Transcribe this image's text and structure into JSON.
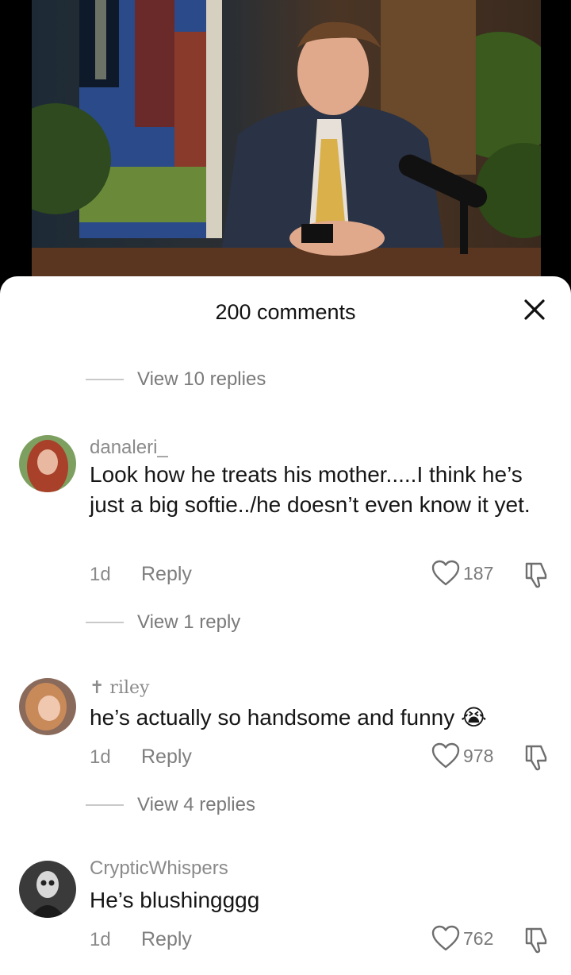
{
  "header": {
    "title": "200 comments"
  },
  "comments": [
    {
      "username": "danaleri_",
      "text": "Look how he treats his mother.....I think he’s just a big softie../he doesn’t even know it yet.",
      "age": "1d",
      "reply_label": "Reply",
      "likes": "187",
      "view_replies": "View 1 reply"
    },
    {
      "username": "✝ riley",
      "text": "he’s actually so handsome and funny",
      "emoji": "😭",
      "age": "1d",
      "reply_label": "Reply",
      "likes": "978",
      "view_replies": "View 4 replies"
    },
    {
      "username": "CrypticWhispers",
      "text": "He’s blushingggg",
      "age": "1d",
      "reply_label": "Reply",
      "likes": "762"
    }
  ],
  "top_view_replies": "View 10 replies",
  "icons": {
    "close": "close-icon",
    "like": "heart-outline-icon",
    "dislike": "thumbs-down-icon"
  },
  "colors": {
    "text_primary": "#161616",
    "text_secondary": "#8a8a8a",
    "background": "#ffffff"
  }
}
